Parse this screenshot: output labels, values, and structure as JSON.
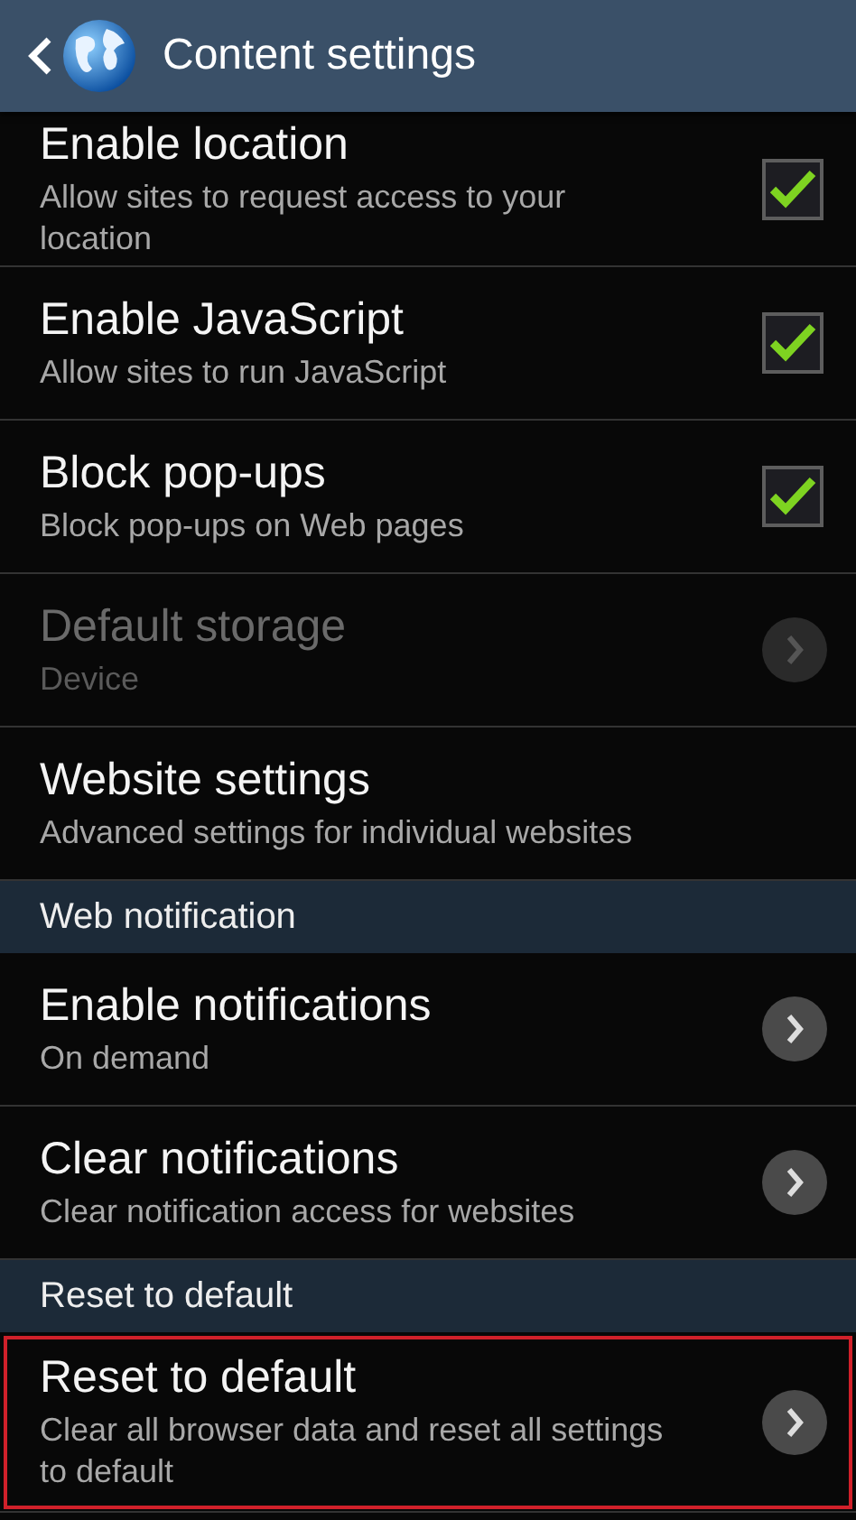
{
  "header": {
    "title": "Content settings"
  },
  "items": [
    {
      "kind": "setting",
      "title": "Enable location",
      "subtitle": "Allow sites to request access to your location",
      "accessory": {
        "kind": "checkbox",
        "checked": true
      },
      "disabled": false,
      "highlighted": false
    },
    {
      "kind": "setting",
      "title": "Enable JavaScript",
      "subtitle": "Allow sites to run JavaScript",
      "accessory": {
        "kind": "checkbox",
        "checked": true
      },
      "disabled": false,
      "highlighted": false
    },
    {
      "kind": "setting",
      "title": "Block pop-ups",
      "subtitle": "Block pop-ups on Web pages",
      "accessory": {
        "kind": "checkbox",
        "checked": true
      },
      "disabled": false,
      "highlighted": false
    },
    {
      "kind": "setting",
      "title": "Default storage",
      "subtitle": "Device",
      "accessory": {
        "kind": "arrow"
      },
      "disabled": true,
      "highlighted": false
    },
    {
      "kind": "setting",
      "title": "Website settings",
      "subtitle": "Advanced settings for individual websites",
      "disabled": false,
      "highlighted": false
    },
    {
      "kind": "section",
      "title": "Web notification"
    },
    {
      "kind": "setting",
      "title": "Enable notifications",
      "subtitle": "On demand",
      "accessory": {
        "kind": "arrow"
      },
      "disabled": false,
      "highlighted": false
    },
    {
      "kind": "setting",
      "title": "Clear notifications",
      "subtitle": "Clear notification access for websites",
      "accessory": {
        "kind": "arrow"
      },
      "disabled": false,
      "highlighted": false
    },
    {
      "kind": "section",
      "title": "Reset to default"
    },
    {
      "kind": "setting",
      "title": "Reset to default",
      "subtitle": "Clear all browser data and reset all settings to default",
      "accessory": {
        "kind": "arrow"
      },
      "disabled": false,
      "highlighted": true
    }
  ]
}
